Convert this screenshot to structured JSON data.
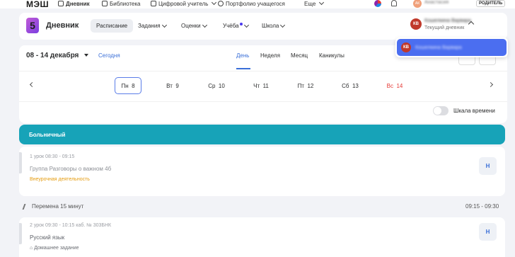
{
  "topbar": {
    "logo": "МЭШ",
    "nav": [
      {
        "label": "Дневник",
        "bold": true
      },
      {
        "label": "Библиотека"
      },
      {
        "label": "Цифровой учитель",
        "dropdown": true
      },
      {
        "label": "Портфолио учащегося"
      },
      {
        "label": "Еще",
        "dropdown": true
      }
    ],
    "avatar": "АК",
    "user": "Анастасия",
    "role": "РОДИТЕЛЬ"
  },
  "header": {
    "logo_digit": "5",
    "title": "Дневник",
    "tabs": [
      {
        "label": "Расписание",
        "active": true
      },
      {
        "label": "Задания",
        "dropdown": true
      },
      {
        "label": "Оценки",
        "dropdown": true
      },
      {
        "label": "Учёба",
        "dropdown": true,
        "dot": true
      },
      {
        "label": "Школа",
        "dropdown": true
      }
    ],
    "profile": {
      "initials": "КВ",
      "name": "Кошелкина Варвара",
      "subtitle": "Текущий дневник"
    }
  },
  "dropdown": {
    "initials": "КВ",
    "name": "Кошелкина Варвара"
  },
  "week": {
    "range": "08 - 14 декабря",
    "today": "Сегодня",
    "views": [
      {
        "label": "День",
        "active": true
      },
      {
        "label": "Неделя"
      },
      {
        "label": "Месяц"
      },
      {
        "label": "Каникулы"
      }
    ],
    "days": [
      {
        "label": "Пн",
        "num": "8",
        "selected": true
      },
      {
        "label": "Вт",
        "num": "9"
      },
      {
        "label": "Ср",
        "num": "10"
      },
      {
        "label": "Чт",
        "num": "11"
      },
      {
        "label": "Пт",
        "num": "12"
      },
      {
        "label": "Сб",
        "num": "13"
      },
      {
        "label": "Вс",
        "num": "14",
        "holiday": true
      }
    ],
    "timescale_label": "Шкала времени"
  },
  "sick_banner": "Больничный",
  "lessons": [
    {
      "meta": "1 урок 08:30 - 09:15",
      "subject": "Группа Разговоры о важном 4б",
      "tag": "Внеурочная деятельность",
      "badge": "Н"
    },
    {
      "meta": "2 урок 09:30 - 10:15 каб. № 303БНК",
      "subject": "Русский язык",
      "homework": "Домашнее задание",
      "badge": "Н"
    }
  ],
  "break": {
    "label": "Перемена 15 минут",
    "time": "09:15 - 09:30"
  },
  "colors": {
    "accent": "#3a6fd8",
    "sick": "#17a3b8",
    "tag": "#e59b0d",
    "holiday": "#e53935"
  }
}
